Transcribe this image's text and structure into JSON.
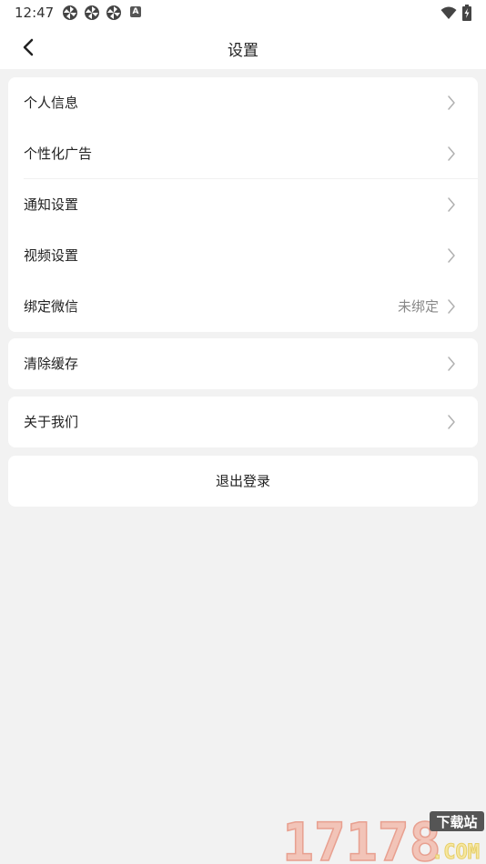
{
  "status_bar": {
    "time": "12:47",
    "notification_icons": [
      "pinwheel-icon",
      "pinwheel-icon",
      "pinwheel-icon"
    ],
    "badge_letter": "A"
  },
  "header": {
    "title": "设置"
  },
  "groups": [
    {
      "items": [
        {
          "label": "个人信息",
          "value": ""
        },
        {
          "label": "个性化广告",
          "value": ""
        },
        {
          "label": "通知设置",
          "value": ""
        },
        {
          "label": "视频设置",
          "value": ""
        },
        {
          "label": "绑定微信",
          "value": "未绑定"
        }
      ]
    },
    {
      "items": [
        {
          "label": "清除缓存",
          "value": ""
        }
      ]
    },
    {
      "items": [
        {
          "label": "关于我们",
          "value": ""
        }
      ]
    }
  ],
  "logout": {
    "label": "退出登录"
  },
  "watermark": {
    "number": "17178",
    "tag": "下载站",
    "domain": ".COM"
  },
  "colors": {
    "background": "#f2f2f2",
    "card": "#ffffff",
    "text": "#222222",
    "secondary_text": "#888888",
    "chevron": "#b0b0b0"
  }
}
